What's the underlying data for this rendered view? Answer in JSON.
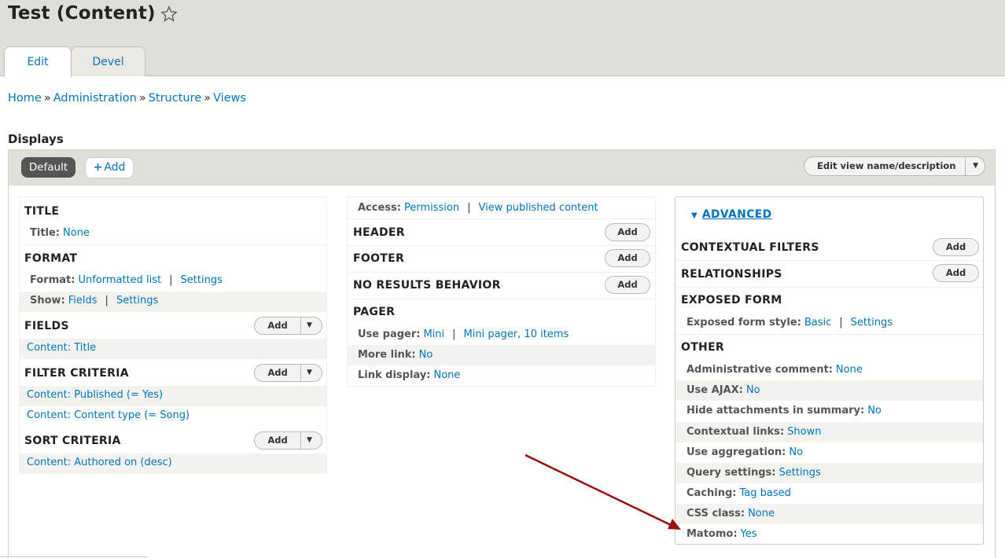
{
  "page": {
    "title": "Test (Content)"
  },
  "tabs": [
    {
      "label": "Edit"
    },
    {
      "label": "Devel"
    }
  ],
  "breadcrumb": [
    {
      "label": "Home"
    },
    {
      "label": "Administration"
    },
    {
      "label": "Structure"
    },
    {
      "label": "Views"
    }
  ],
  "breadcrumb_separator": "»",
  "displays": {
    "label": "Displays",
    "default_label": "Default",
    "add_label": "Add",
    "add_icon": "+",
    "edit_view_label": "Edit view name/description",
    "dropdown_caret": "▼"
  },
  "column1": {
    "title": {
      "heading": "TITLE",
      "label": "Title:",
      "value": "None"
    },
    "format": {
      "heading": "FORMAT",
      "format_label": "Format:",
      "format_value": "Unformatted list",
      "format_settings": "Settings",
      "show_label": "Show:",
      "show_value": "Fields",
      "show_settings": "Settings"
    },
    "fields": {
      "heading": "FIELDS",
      "add": "Add",
      "items": [
        "Content: Title"
      ]
    },
    "filter": {
      "heading": "FILTER CRITERIA",
      "add": "Add",
      "items": [
        "Content: Published (= Yes)",
        "Content: Content type (= Song)"
      ]
    },
    "sort": {
      "heading": "SORT CRITERIA",
      "add": "Add",
      "items": [
        "Content: Authored on (desc)"
      ]
    }
  },
  "column2": {
    "access": {
      "label": "Access:",
      "value": "Permission",
      "detail": "View published content"
    },
    "header": {
      "heading": "HEADER",
      "add": "Add"
    },
    "footer": {
      "heading": "FOOTER",
      "add": "Add"
    },
    "no_results": {
      "heading": "NO RESULTS BEHAVIOR",
      "add": "Add"
    },
    "pager": {
      "heading": "PAGER",
      "use_pager_label": "Use pager:",
      "use_pager_value": "Mini",
      "use_pager_detail": "Mini pager, 10 items",
      "more_link_label": "More link:",
      "more_link_value": "No",
      "link_display_label": "Link display:",
      "link_display_value": "None"
    }
  },
  "column3": {
    "advanced_label": "ADVANCED",
    "advanced_toggle": "▼",
    "contextual": {
      "heading": "CONTEXTUAL FILTERS",
      "add": "Add"
    },
    "relationships": {
      "heading": "RELATIONSHIPS",
      "add": "Add"
    },
    "exposed": {
      "heading": "EXPOSED FORM",
      "label": "Exposed form style:",
      "value": "Basic",
      "settings": "Settings"
    },
    "other": {
      "heading": "OTHER",
      "items": [
        {
          "label": "Administrative comment:",
          "value": "None"
        },
        {
          "label": "Use AJAX:",
          "value": "No"
        },
        {
          "label": "Hide attachments in summary:",
          "value": "No"
        },
        {
          "label": "Contextual links:",
          "value": "Shown"
        },
        {
          "label": "Use aggregation:",
          "value": "No"
        },
        {
          "label": "Query settings:",
          "value": "Settings"
        },
        {
          "label": "Caching:",
          "value": "Tag based"
        },
        {
          "label": "CSS class:",
          "value": "None"
        },
        {
          "label": "Matomo:",
          "value": "Yes"
        }
      ]
    }
  },
  "colors": {
    "link": "#0074bd",
    "annotation_arrow": "#9b0d0d",
    "header_bg": "#e0ded8"
  },
  "icons": {
    "favorite": "star-icon",
    "pointer": "arrow-annotation"
  }
}
